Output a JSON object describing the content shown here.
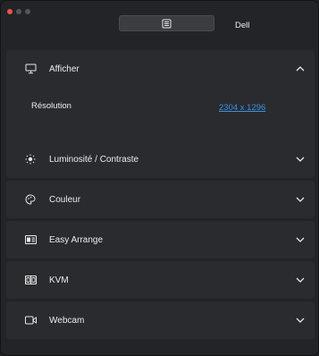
{
  "window": {
    "device_name": "Dell"
  },
  "sections": [
    {
      "id": "display",
      "label": "Afficher",
      "icon": "monitor-icon",
      "expanded": true
    },
    {
      "id": "brightness",
      "label": "Luminosité / Contraste",
      "icon": "sun-icon",
      "expanded": false
    },
    {
      "id": "color",
      "label": "Couleur",
      "icon": "palette-icon",
      "expanded": false
    },
    {
      "id": "easy_arrange",
      "label": "Easy Arrange",
      "icon": "layout-icon",
      "expanded": false
    },
    {
      "id": "kvm",
      "label": "KVM",
      "icon": "kvm-icon",
      "expanded": false
    },
    {
      "id": "webcam",
      "label": "Webcam",
      "icon": "camera-icon",
      "expanded": false
    }
  ],
  "display": {
    "resolution_label": "Résolution",
    "resolution_value": "2304 x 1296"
  },
  "colors": {
    "link": "#3d8fe0",
    "panel": "#2a2b2f",
    "background": "#232427"
  }
}
